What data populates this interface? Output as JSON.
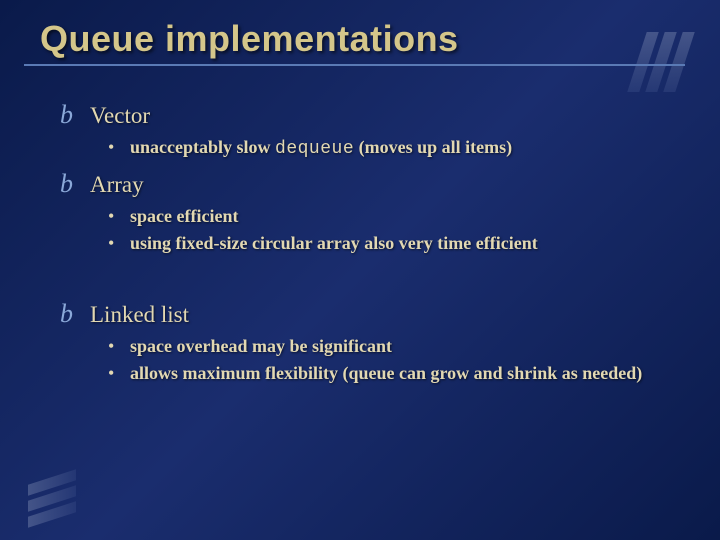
{
  "title": "Queue implementations",
  "items": [
    {
      "label": "Vector",
      "sub": [
        {
          "pre": "unacceptably slow ",
          "mono": "dequeue",
          "post": " (moves up all items)"
        }
      ]
    },
    {
      "label": "Array",
      "sub": [
        {
          "pre": "space efficient",
          "mono": "",
          "post": ""
        },
        {
          "pre": "using fixed-size circular array also very time efficient",
          "mono": "",
          "post": ""
        }
      ]
    },
    {
      "label": "Linked list",
      "gap": true,
      "sub": [
        {
          "pre": "space overhead may be significant",
          "mono": "",
          "post": ""
        },
        {
          "pre": "allows maximum flexibility (queue can grow and shrink as needed)",
          "mono": "",
          "post": ""
        }
      ]
    }
  ]
}
